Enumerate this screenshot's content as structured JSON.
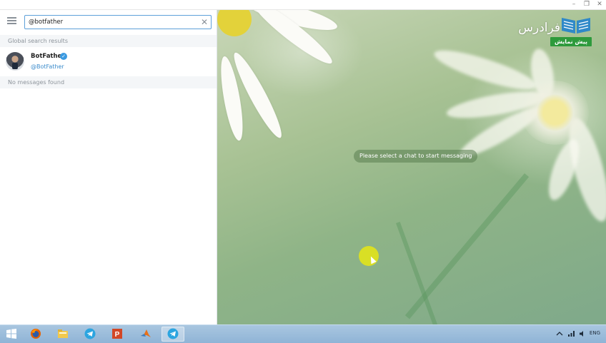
{
  "window": {
    "controls": [
      "minimize-icon",
      "restore-icon",
      "close-icon"
    ]
  },
  "sidebar": {
    "search": {
      "value": "@botfather",
      "placeholder": "Search",
      "clear_icon": "close-icon"
    },
    "sections": {
      "global": "Global search results",
      "messages": "No messages found"
    },
    "result": {
      "name": "BotFather",
      "username": "@BotFather",
      "verified_icon": "check-badge-icon"
    }
  },
  "chat": {
    "empty_message": "Please select a chat to start messaging"
  },
  "watermark": {
    "title": "فرادرس",
    "badge": "پیش نمایش"
  },
  "taskbar": {
    "apps": [
      "windows-start-icon",
      "firefox-icon",
      "file-explorer-icon",
      "telegram-icon",
      "powerpoint-icon",
      "matlab-icon",
      "telegram-icon"
    ],
    "language": "ENG"
  },
  "colors": {
    "accent": "#5ea0d9",
    "link": "#3c8ccc",
    "verified": "#3b9ae1",
    "badge": "#2e9a3c"
  }
}
